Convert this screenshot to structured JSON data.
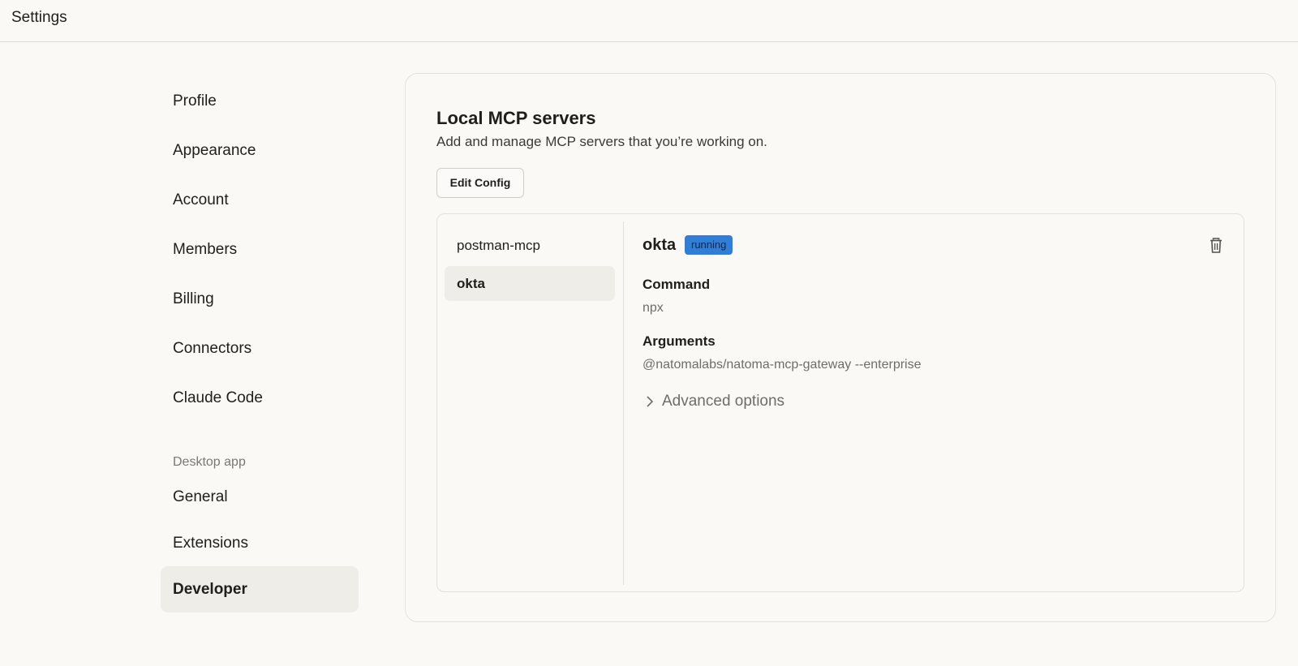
{
  "window": {
    "title": "Settings"
  },
  "sidebar": {
    "items": [
      {
        "label": "Profile"
      },
      {
        "label": "Appearance"
      },
      {
        "label": "Account"
      },
      {
        "label": "Members"
      },
      {
        "label": "Billing"
      },
      {
        "label": "Connectors"
      },
      {
        "label": "Claude Code"
      }
    ],
    "desktop_section": {
      "heading": "Desktop app",
      "items": [
        {
          "label": "General"
        },
        {
          "label": "Extensions"
        },
        {
          "label": "Developer",
          "active": true
        }
      ]
    }
  },
  "main": {
    "title": "Local MCP servers",
    "subtitle": "Add and manage MCP servers that you’re working on.",
    "edit_button": "Edit Config",
    "servers": [
      {
        "name": "postman-mcp"
      },
      {
        "name": "okta",
        "active": true
      }
    ],
    "detail": {
      "name": "okta",
      "status": "running",
      "status_color": "#2f7fd9",
      "command_label": "Command",
      "command": "npx",
      "arguments_label": "Arguments",
      "arguments": "@natomalabs/natoma-mcp-gateway --enterprise",
      "advanced_label": "Advanced options",
      "delete_icon": "trash-icon",
      "advanced_icon": "chevron-right-icon"
    }
  }
}
